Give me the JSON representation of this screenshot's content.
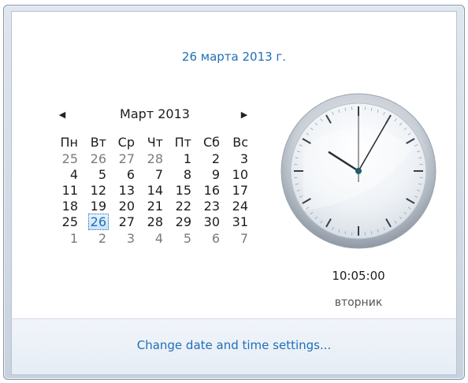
{
  "header": {
    "date_text": "26 марта 2013 г."
  },
  "calendar": {
    "month_title": "Март 2013",
    "prev_icon": "◀",
    "next_icon": "▶",
    "weekdays": [
      "Пн",
      "Вт",
      "Ср",
      "Чт",
      "Пт",
      "Сб",
      "Вс"
    ],
    "weeks": [
      [
        "25",
        "26",
        "27",
        "28",
        "1",
        "2",
        "3"
      ],
      [
        "4",
        "5",
        "6",
        "7",
        "8",
        "9",
        "10"
      ],
      [
        "11",
        "12",
        "13",
        "14",
        "15",
        "16",
        "17"
      ],
      [
        "18",
        "19",
        "20",
        "21",
        "22",
        "23",
        "24"
      ],
      [
        "25",
        "26",
        "27",
        "28",
        "29",
        "30",
        "31"
      ],
      [
        "1",
        "2",
        "3",
        "4",
        "5",
        "6",
        "7"
      ]
    ],
    "today_week": 4,
    "today_day": 1
  },
  "clock": {
    "time_text": "10:05:00",
    "weekday_text": "вторник",
    "hours": 10,
    "minutes": 5,
    "seconds": 0
  },
  "footer": {
    "settings_link": "Change date and time settings..."
  },
  "colors": {
    "link": "#1f6fb8",
    "other_month": "#7b7b7b"
  }
}
